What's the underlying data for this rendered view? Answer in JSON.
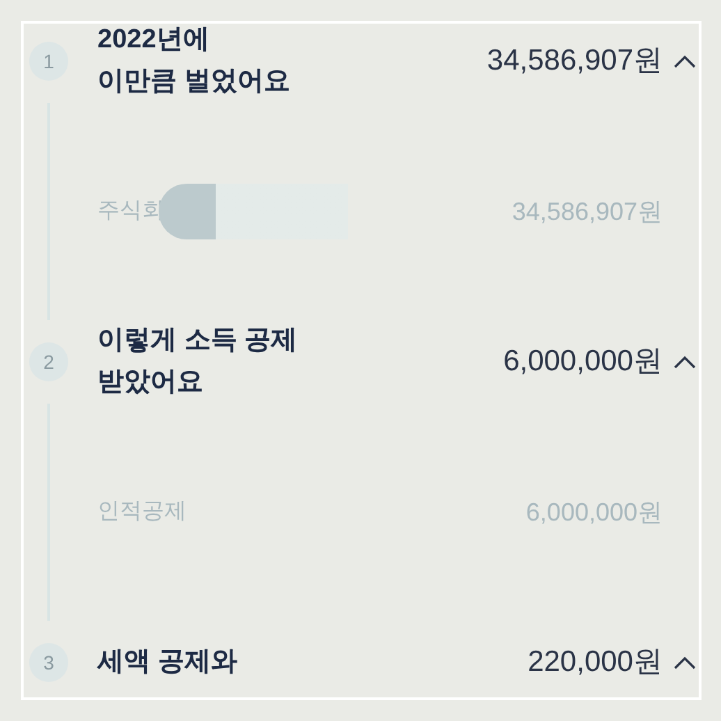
{
  "steps": [
    {
      "number": "1",
      "title_lines": [
        "2022년에",
        "이만큼 벌었어요"
      ],
      "amount": "34,586,907원",
      "expanded": true,
      "items": [
        {
          "label": "주식회",
          "amount": "34,586,907원",
          "redacted": true
        }
      ]
    },
    {
      "number": "2",
      "title_lines": [
        "이렇게 소득 공제",
        "받았어요"
      ],
      "amount": "6,000,000원",
      "expanded": true,
      "items": [
        {
          "label": "인적공제",
          "amount": "6,000,000원",
          "redacted": false
        }
      ]
    },
    {
      "number": "3",
      "title_lines": [
        "세액 공제와"
      ],
      "amount": "220,000원",
      "expanded": true
    }
  ]
}
